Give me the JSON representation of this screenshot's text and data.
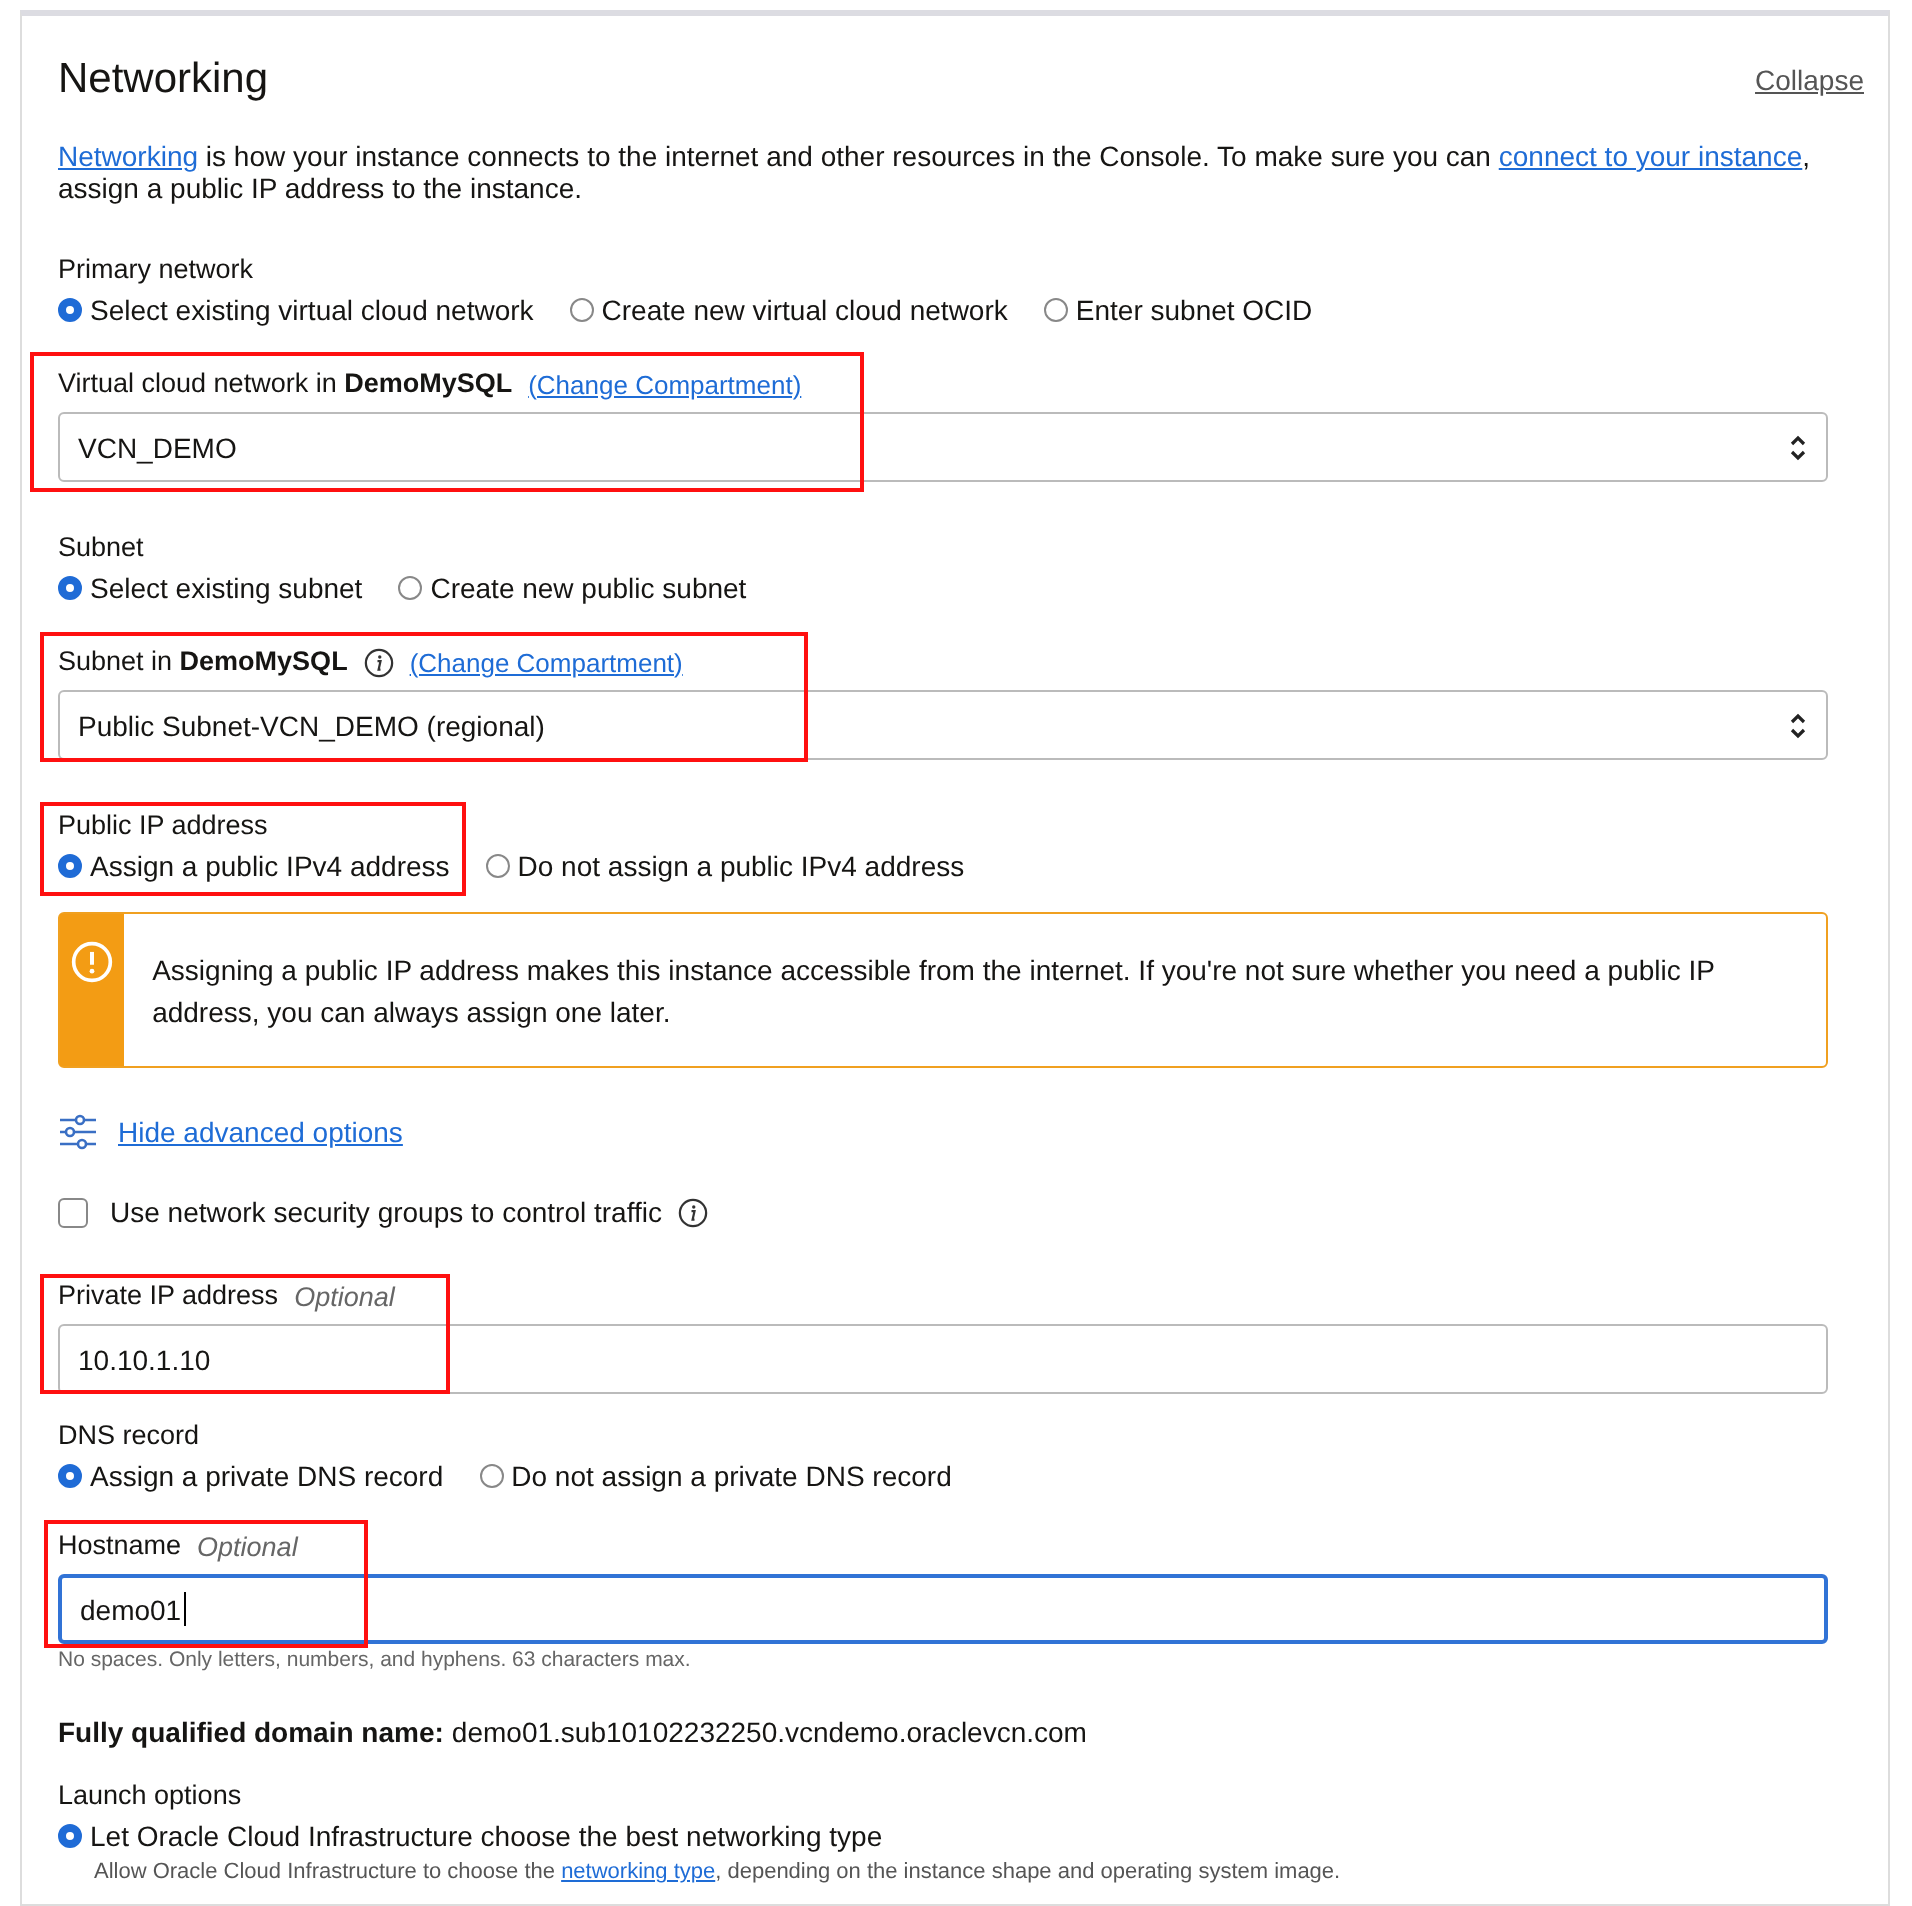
{
  "section": {
    "title": "Networking",
    "collapse": "Collapse",
    "description": [
      {
        "kind": "link",
        "text": "Networking"
      },
      {
        "kind": "text",
        "text": " is how your instance connects to the internet and other resources in the Console. To make sure you can "
      },
      {
        "kind": "link",
        "text": "connect to your instance"
      },
      {
        "kind": "text",
        "text": ", assign a public IP address to the instance."
      }
    ]
  },
  "fields": [
    {
      "kind": "radio-group",
      "label": "Primary network",
      "annotated": false,
      "options": [
        {
          "label": "Select existing virtual cloud network",
          "selected": true
        },
        {
          "label": "Create new virtual cloud network",
          "selected": false
        },
        {
          "label": "Enter subnet OCID",
          "selected": false
        }
      ]
    },
    {
      "kind": "select",
      "label": "Virtual cloud network in **DemoMySQL**",
      "info": false,
      "link": "(Change Compartment)",
      "value": "VCN_DEMO",
      "annotated": true
    },
    {
      "kind": "radio-group",
      "label": "Subnet",
      "annotated": false,
      "options": [
        {
          "label": "Select existing subnet",
          "selected": true
        },
        {
          "label": "Create new public subnet",
          "selected": false
        }
      ]
    },
    {
      "kind": "select",
      "label": "Subnet in **DemoMySQL**",
      "info": true,
      "link": "(Change Compartment)",
      "value": "Public Subnet-VCN_DEMO (regional)",
      "annotated": true
    },
    {
      "kind": "radio-group",
      "label": "Public IP address",
      "annotated": true,
      "options": [
        {
          "label": "Assign a public IPv4 address",
          "selected": true
        },
        {
          "label": "Do not assign a public IPv4 address",
          "selected": false
        }
      ]
    },
    {
      "kind": "alert",
      "text": "Assigning a public IP address makes this instance accessible from the internet. If you're not sure whether you need a public IP address, you can always assign one later."
    },
    {
      "kind": "toggle",
      "label": "Hide advanced options"
    },
    {
      "kind": "checkbox",
      "label": "Use network security groups to control traffic",
      "checked": false,
      "info": true
    },
    {
      "kind": "text-input",
      "label": "Private IP address",
      "optional": "Optional",
      "value": "10.10.1.10",
      "focused": false,
      "annotated": true
    },
    {
      "kind": "radio-group",
      "label": "DNS record",
      "annotated": false,
      "options": [
        {
          "label": "Assign a private DNS record",
          "selected": true
        },
        {
          "label": "Do not assign a private DNS record",
          "selected": false
        }
      ]
    },
    {
      "kind": "text-input",
      "label": "Hostname",
      "optional": "Optional",
      "value": "demo01",
      "focused": true,
      "helper": "No spaces. Only letters, numbers, and hyphens. 63 characters max.",
      "annotated": true
    },
    {
      "kind": "fqdn",
      "label": "Fully qualified domain name:",
      "value": "demo01.sub10102232250.vcndemo.oraclevcn.com"
    },
    {
      "kind": "radio-group",
      "label": "Launch options",
      "annotated": false,
      "options": [
        {
          "label": "Let Oracle Cloud Infrastructure choose the best networking type",
          "selected": true,
          "help": [
            {
              "kind": "text",
              "text": "Allow Oracle Cloud Infrastructure to choose the "
            },
            {
              "kind": "link",
              "text": "networking type"
            },
            {
              "kind": "text",
              "text": ", depending on the instance shape and operating system image."
            }
          ]
        }
      ]
    }
  ]
}
